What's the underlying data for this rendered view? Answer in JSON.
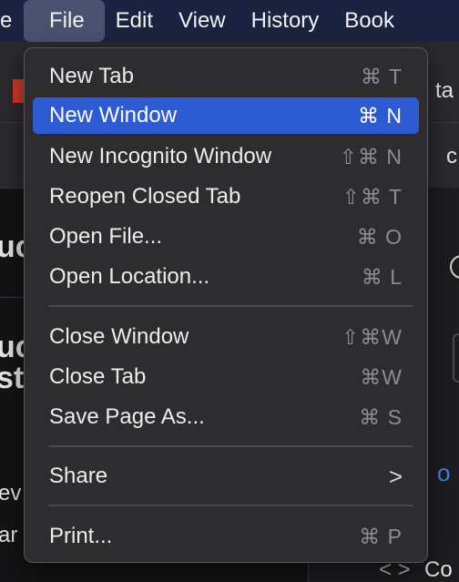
{
  "menubar": {
    "items": [
      {
        "label": "e"
      },
      {
        "label": "File"
      },
      {
        "label": "Edit"
      },
      {
        "label": "View"
      },
      {
        "label": "History"
      },
      {
        "label": "Book"
      }
    ]
  },
  "background": {
    "tab_fragment": "ta",
    "address_fragment": "c",
    "heading_fragment": "uc",
    "title_fragment_1": "uc",
    "title_fragment_2": "st",
    "line_fragment_1": "ev",
    "line_fragment_2": "ar",
    "link_fragment": "o",
    "code_glyph": "< >",
    "code_text": "Co"
  },
  "file_menu": {
    "items": [
      {
        "label": "New Tab",
        "shortcut": "⌘ T"
      },
      {
        "label": "New Window",
        "shortcut": "⌘ N",
        "highlighted": true
      },
      {
        "label": "New Incognito Window",
        "shortcut": "⇧⌘ N"
      },
      {
        "label": "Reopen Closed Tab",
        "shortcut": "⇧⌘ T"
      },
      {
        "label": "Open File...",
        "shortcut": "⌘ O"
      },
      {
        "label": "Open Location...",
        "shortcut": "⌘ L"
      },
      {
        "label": "Close Window",
        "shortcut": "⇧⌘W"
      },
      {
        "label": "Close Tab",
        "shortcut": "⌘W"
      },
      {
        "label": "Save Page As...",
        "shortcut": "⌘ S"
      },
      {
        "label": "Share",
        "submenu_indicator": ">"
      },
      {
        "label": "Print...",
        "shortcut": "⌘ P"
      }
    ]
  },
  "colors": {
    "menubar_bg": "#1b2340",
    "menu_bg": "#2d2d30",
    "highlight": "#2c5bd4",
    "shortcut_text": "#8c8c90"
  }
}
